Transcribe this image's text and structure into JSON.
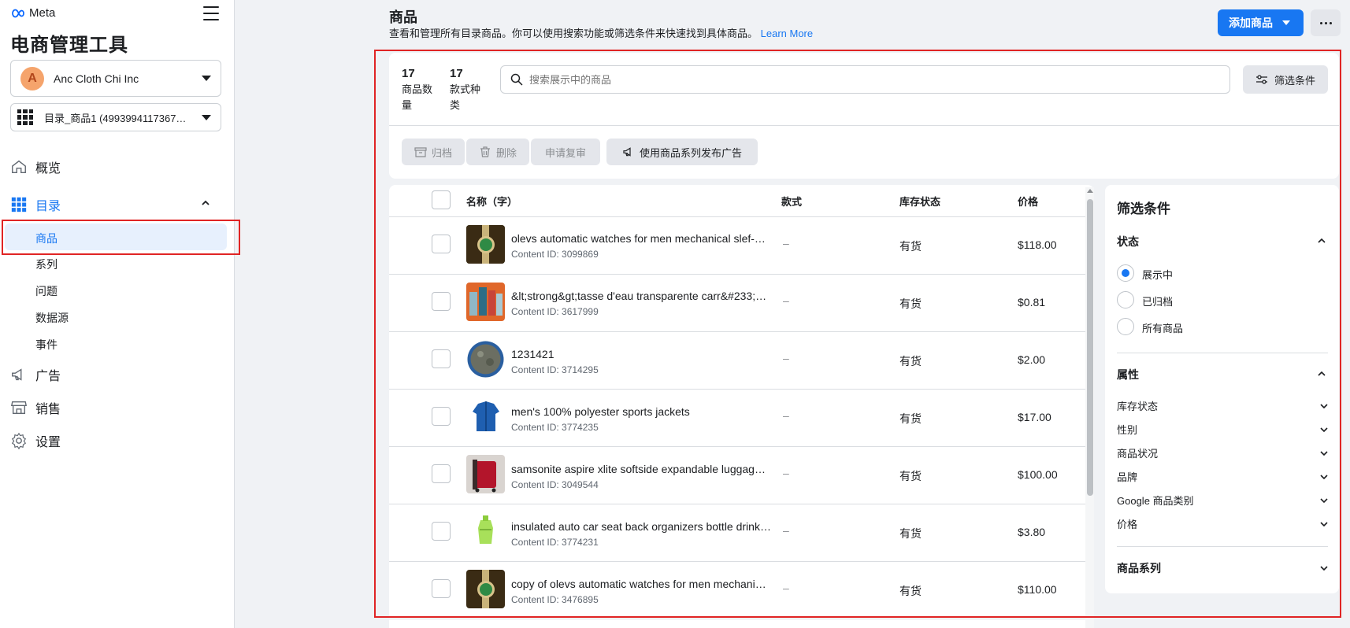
{
  "brand": {
    "logo_text": "Meta",
    "accent": "#1877f2"
  },
  "app": {
    "title": "电商管理工具"
  },
  "account": {
    "initial": "A",
    "name": "Anc Cloth Chi Inc"
  },
  "catalog": {
    "name": "目录_商品1 (4993994117367…"
  },
  "nav": {
    "overview": "概览",
    "catalog": "目录",
    "catalog_sub": {
      "products": "商品",
      "series": "系列",
      "issues": "问题",
      "datasource": "数据源",
      "events": "事件"
    },
    "ads": "广告",
    "sales": "销售",
    "settings": "设置"
  },
  "header": {
    "title": "商品",
    "description": "查看和管理所有目录商品。你可以使用搜索功能或筛选条件来快速找到具体商品。",
    "learn_more": "Learn More",
    "add_button": "添加商品"
  },
  "stats": {
    "product_count": "17",
    "product_label_1": "商品数",
    "product_label_2": "量",
    "variant_count": "17",
    "variant_label_1": "款式种",
    "variant_label_2": "类"
  },
  "search": {
    "placeholder": "搜索展示中的商品"
  },
  "filter_button": "筛选条件",
  "actions": {
    "archive": "归档",
    "delete": "删除",
    "review": "申请复审",
    "ads": "使用商品系列发布广告"
  },
  "table": {
    "headers": {
      "name": "名称（字）",
      "variant": "款式",
      "stock": "库存状态",
      "price": "价格"
    },
    "rows": [
      {
        "name": "olevs automatic watches for men mechanical slef-…",
        "content_id": "Content ID: 3099869",
        "variant": "–",
        "stock": "有货",
        "price": "$118.00"
      },
      {
        "name": "&lt;strong&gt;tasse d'eau transparente carr&#233;e…",
        "content_id": "Content ID: 3617999",
        "variant": "–",
        "stock": "有货",
        "price": "$0.81"
      },
      {
        "name": "1231421",
        "content_id": "Content ID: 3714295",
        "variant": "–",
        "stock": "有货",
        "price": "$2.00"
      },
      {
        "name": "men's 100% polyester sports jackets",
        "content_id": "Content ID: 3774235",
        "variant": "–",
        "stock": "有货",
        "price": "$17.00"
      },
      {
        "name": "samsonite aspire xlite softside expandable luggage…",
        "content_id": "Content ID: 3049544",
        "variant": "–",
        "stock": "有货",
        "price": "$100.00"
      },
      {
        "name": "insulated auto car seat back organizers bottle drink…",
        "content_id": "Content ID: 3774231",
        "variant": "–",
        "stock": "有货",
        "price": "$3.80"
      },
      {
        "name": "copy of olevs automatic watches for men mechani…",
        "content_id": "Content ID: 3476895",
        "variant": "–",
        "stock": "有货",
        "price": "$110.00"
      }
    ]
  },
  "filters": {
    "title": "筛选条件",
    "status_title": "状态",
    "status_options": [
      "展示中",
      "已归档",
      "所有商品"
    ],
    "status_selected": "展示中",
    "attributes_title": "属性",
    "attributes": [
      "库存状态",
      "性别",
      "商品状况",
      "品牌",
      "Google 商品类别",
      "价格"
    ],
    "series_title": "商品系列"
  }
}
